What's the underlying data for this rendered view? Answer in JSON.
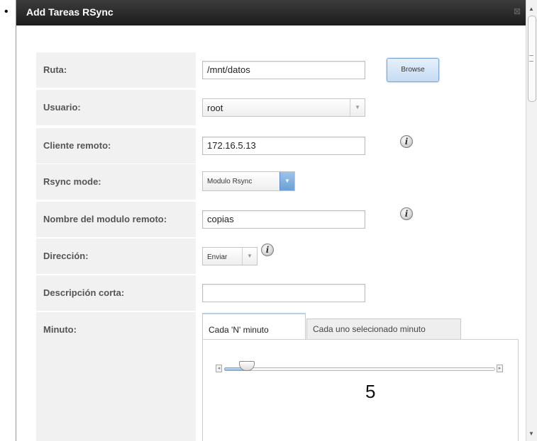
{
  "dialog": {
    "title": "Add Tareas RSync",
    "close_symbol": "⊠"
  },
  "fields": {
    "ruta": {
      "label": "Ruta:",
      "value": "/mnt/datos"
    },
    "browse_label": "Browse",
    "usuario": {
      "label": "Usuario:",
      "value": "root"
    },
    "cliente_remoto": {
      "label": "Cliente remoto:",
      "value": "172.16.5.13"
    },
    "rsync_mode": {
      "label": "Rsync mode:",
      "value": "Modulo Rsync"
    },
    "nombre_modulo": {
      "label": "Nombre del modulo remoto:",
      "value": "copias"
    },
    "direccion": {
      "label": "Dirección:",
      "value": "Enviar"
    },
    "descripcion": {
      "label": "Descripción corta:",
      "value": ""
    },
    "minuto": {
      "label": "Minuto:"
    }
  },
  "info_icon_glyph": "i",
  "minute_tabs": [
    {
      "label": "Cada 'N' minuto",
      "active": true
    },
    {
      "label": "Cada uno selecionado minuto",
      "active": false
    }
  ],
  "slider": {
    "value": "5",
    "value_number": 5,
    "max": 60
  },
  "icons": {
    "info": "info-icon",
    "dropdown": "chevron-down-icon",
    "close": "close-icon"
  },
  "colors": {
    "titlebar": "#2a2a2a",
    "label_bg": "#f1f1f1",
    "accent_blue": "#7aa7d6"
  }
}
